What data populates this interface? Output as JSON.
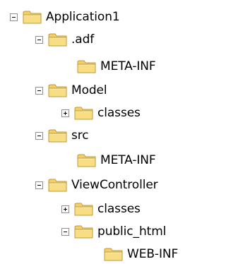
{
  "tree": {
    "nodes": [
      {
        "label": "Application1",
        "toggle": "expanded",
        "name": "tree-node-application1"
      },
      {
        "label": ".adf",
        "toggle": "expanded",
        "name": "tree-node-adf"
      },
      {
        "label": "META-INF",
        "toggle": "none",
        "name": "tree-node-adf-meta-inf"
      },
      {
        "label": "Model",
        "toggle": "expanded",
        "name": "tree-node-model"
      },
      {
        "label": "classes",
        "toggle": "collapsed",
        "name": "tree-node-model-classes"
      },
      {
        "label": "src",
        "toggle": "expanded",
        "name": "tree-node-src"
      },
      {
        "label": "META-INF",
        "toggle": "none",
        "name": "tree-node-src-meta-inf"
      },
      {
        "label": "ViewController",
        "toggle": "expanded",
        "name": "tree-node-viewcontroller"
      },
      {
        "label": "classes",
        "toggle": "collapsed",
        "name": "tree-node-viewcontroller-classes"
      },
      {
        "label": "public_html",
        "toggle": "expanded",
        "name": "tree-node-public-html"
      },
      {
        "label": "WEB-INF",
        "toggle": "none",
        "name": "tree-node-web-inf"
      }
    ],
    "icon": "folder-icon"
  }
}
